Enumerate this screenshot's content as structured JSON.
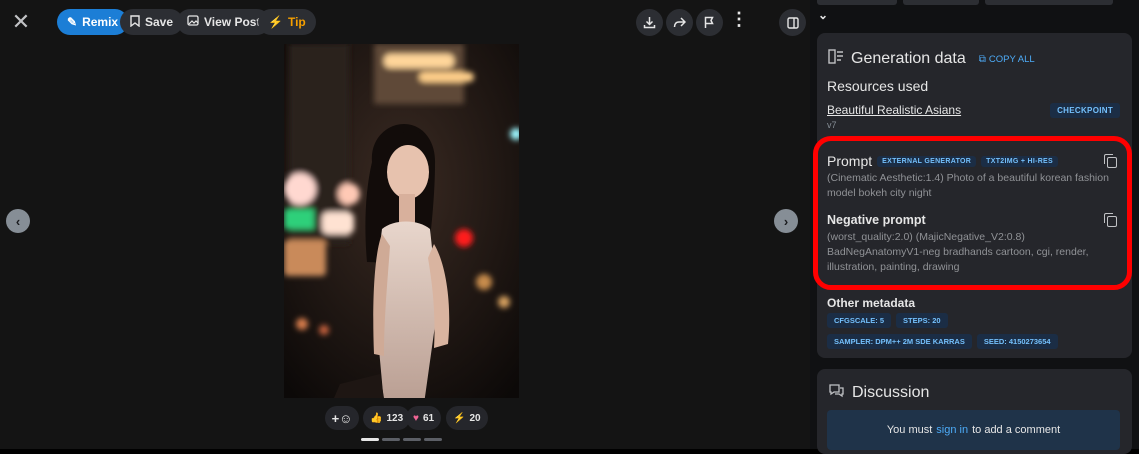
{
  "toolbar": {
    "remix_label": "Remix",
    "save_label": "Save",
    "view_post_label": "View Post",
    "tip_label": "Tip"
  },
  "reactions": {
    "thumbs_count": "123",
    "heart_count": "61",
    "bolt_count": "20"
  },
  "colors": {
    "accent": "#1c7ed6",
    "highlight": "#ff0000",
    "badge_text": "#74c0fc"
  },
  "generation": {
    "title": "Generation data",
    "copy_all": "COPY ALL",
    "resources_heading": "Resources used",
    "resource": {
      "name": "Beautiful Realistic Asians",
      "version": "v7",
      "type": "CHECKPOINT"
    },
    "prompt_heading": "Prompt",
    "prompt_badges": [
      "EXTERNAL GENERATOR",
      "TXT2IMG + HI-RES"
    ],
    "prompt_text": "(Cinematic Aesthetic:1.4) Photo of a beautiful korean fashion model bokeh city night",
    "negative_heading": "Negative prompt",
    "negative_text": "(worst_quality:2.0) (MajicNegative_V2:0.8) BadNegAnatomyV1-neg bradhands cartoon, cgi, render, illustration, painting, drawing",
    "other_heading": "Other metadata",
    "metadata": [
      "CFGSCALE: 5",
      "STEPS: 20",
      "SAMPLER: DPM++ 2M SDE KARRAS",
      "SEED: 4150273654"
    ]
  },
  "discussion": {
    "title": "Discussion",
    "prefix": "You must",
    "link": "sign in",
    "suffix": "to add a comment"
  }
}
